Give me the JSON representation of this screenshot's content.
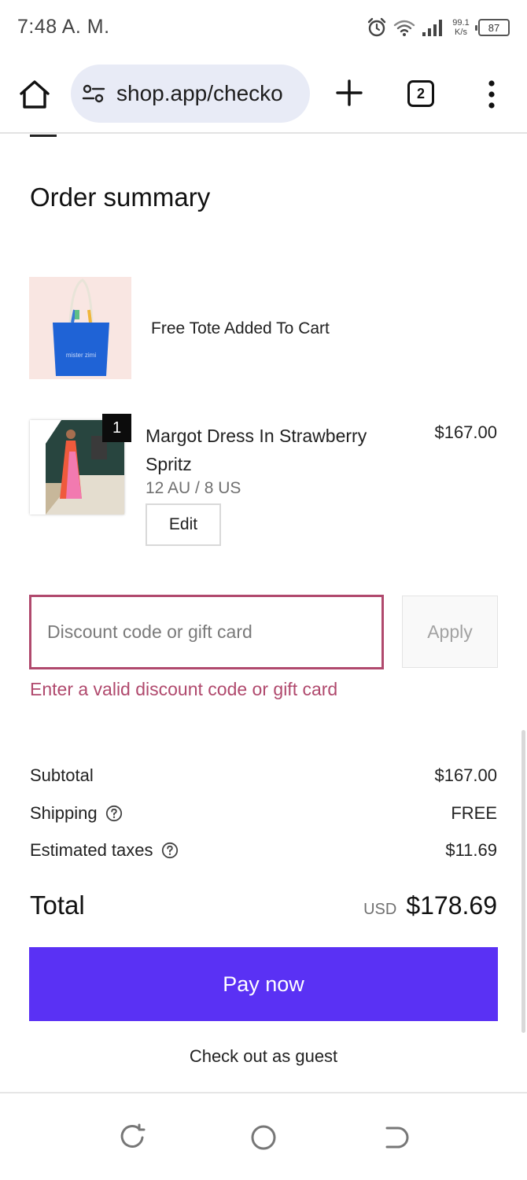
{
  "status_bar": {
    "time": "7:48 A. M.",
    "net_speed_value": "99.1",
    "net_speed_unit": "K/s",
    "battery": "87",
    "icons": [
      "alarm-icon",
      "wifi-icon",
      "signal-icon",
      "battery-icon"
    ]
  },
  "browser": {
    "url": "shop.app/checko",
    "tab_count": "2",
    "icons": [
      "home-icon",
      "site-settings-icon",
      "new-tab-plus-icon",
      "tab-switcher-icon",
      "more-menu-icon"
    ]
  },
  "order_summary": {
    "title": "Order summary",
    "items": [
      {
        "name": "Free Tote Added To Cart",
        "image_text": "mister zimi"
      },
      {
        "name": "Margot Dress In Strawberry Spritz",
        "variant": "12 AU / 8 US",
        "price": "$167.00",
        "quantity": "1",
        "edit_label": "Edit"
      }
    ]
  },
  "discount": {
    "placeholder": "Discount code or gift card",
    "value": "",
    "apply_label": "Apply",
    "error": "Enter a valid discount code or gift card"
  },
  "totals": {
    "subtotal_label": "Subtotal",
    "subtotal_value": "$167.00",
    "shipping_label": "Shipping",
    "shipping_value": "FREE",
    "taxes_label": "Estimated taxes",
    "taxes_value": "$11.69",
    "total_label": "Total",
    "currency": "USD",
    "total_value": "$178.69"
  },
  "actions": {
    "pay_label": "Pay now",
    "guest_label": "Check out as guest"
  },
  "colors": {
    "accent": "#5a31f4",
    "error": "#b0496d",
    "url_bar_bg": "#e8ebf6"
  }
}
